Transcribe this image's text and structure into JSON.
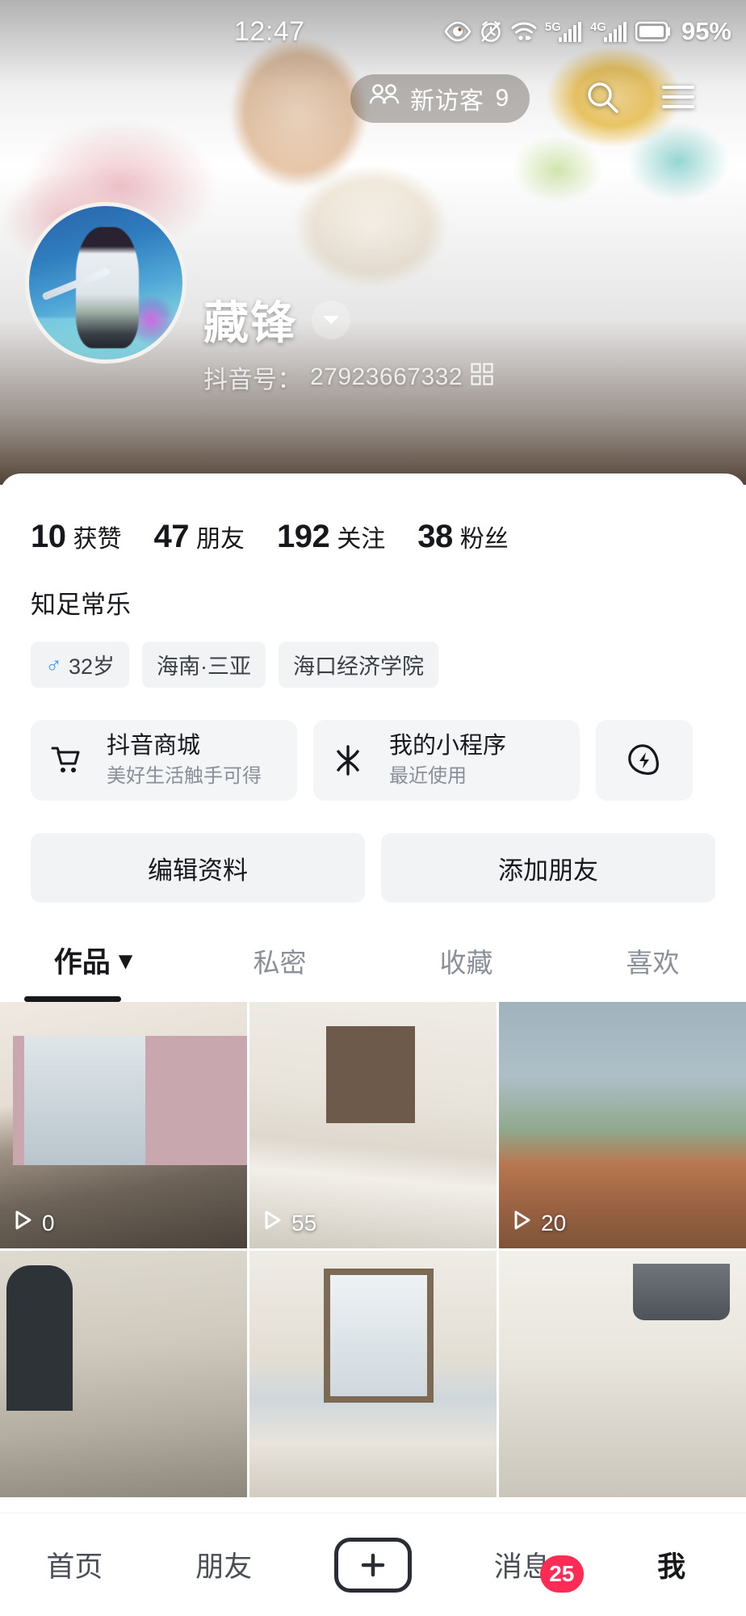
{
  "status_bar": {
    "time": "12:47",
    "battery_percent": "95%",
    "icons": [
      "eye-care-icon",
      "alarm-icon",
      "wifi-icon",
      "signal-5g-icon",
      "signal-4g-icon",
      "battery-icon"
    ],
    "network_labels": {
      "sim1": "5G",
      "sim2": "4G"
    }
  },
  "header": {
    "visitor_pill": {
      "label": "新访客",
      "count": "9",
      "icon": "visitors-icon"
    },
    "search_icon": "search-icon",
    "menu_icon": "hamburger-menu-icon"
  },
  "profile": {
    "avatar": "user-avatar",
    "username": "藏锋",
    "name_chevron_icon": "chevron-down-icon",
    "douyin_id_label": "抖音号：",
    "douyin_id_value": "27923667332",
    "qr_icon": "qr-code-icon",
    "bio": "知足常乐",
    "tags": [
      {
        "icon": "male-gender-icon",
        "symbol": "♂",
        "label": "32岁"
      },
      {
        "icon": null,
        "symbol": "",
        "label": "海南·三亚"
      },
      {
        "icon": null,
        "symbol": "",
        "label": "海口经济学院"
      }
    ]
  },
  "stats": [
    {
      "num": "10",
      "label": "获赞"
    },
    {
      "num": "47",
      "label": "朋友"
    },
    {
      "num": "192",
      "label": "关注"
    },
    {
      "num": "38",
      "label": "粉丝"
    }
  ],
  "service_cards": [
    {
      "icon": "shopping-cart-icon",
      "title": "抖音商城",
      "subtitle": "美好生活触手可得"
    },
    {
      "icon": "mini-program-icon",
      "title": "我的小程序",
      "subtitle": "最近使用"
    },
    {
      "icon": "lightning-bolt-icon",
      "title": "",
      "subtitle": ""
    }
  ],
  "actions": [
    {
      "label": "编辑资料"
    },
    {
      "label": "添加朋友"
    }
  ],
  "tabs": [
    {
      "label": "作品",
      "active": true,
      "chevron": "▾"
    },
    {
      "label": "私密",
      "active": false,
      "chevron": ""
    },
    {
      "label": "收藏",
      "active": false,
      "chevron": ""
    },
    {
      "label": "喜欢",
      "active": false,
      "chevron": ""
    }
  ],
  "videos": [
    {
      "play_count": "0",
      "play_icon": "play-icon"
    },
    {
      "play_count": "55",
      "play_icon": "play-icon"
    },
    {
      "play_count": "20",
      "play_icon": "play-icon"
    },
    {
      "play_count": "",
      "play_icon": "play-icon"
    },
    {
      "play_count": "",
      "play_icon": "play-icon"
    },
    {
      "play_count": "",
      "play_icon": "play-icon"
    }
  ],
  "bottom_nav": [
    {
      "label": "首页",
      "active": false,
      "badge": ""
    },
    {
      "label": "朋友",
      "active": false,
      "badge": ""
    },
    {
      "label": "",
      "active": false,
      "badge": "",
      "icon": "plus-create-icon"
    },
    {
      "label": "消息",
      "active": false,
      "badge": "25"
    },
    {
      "label": "我",
      "active": true,
      "badge": ""
    }
  ],
  "colors": {
    "accent_red": "#fe2c55",
    "text_primary": "#16181c",
    "text_muted": "#8a8f99",
    "chip_bg": "#f2f3f5",
    "male_blue": "#3a9bf5"
  }
}
